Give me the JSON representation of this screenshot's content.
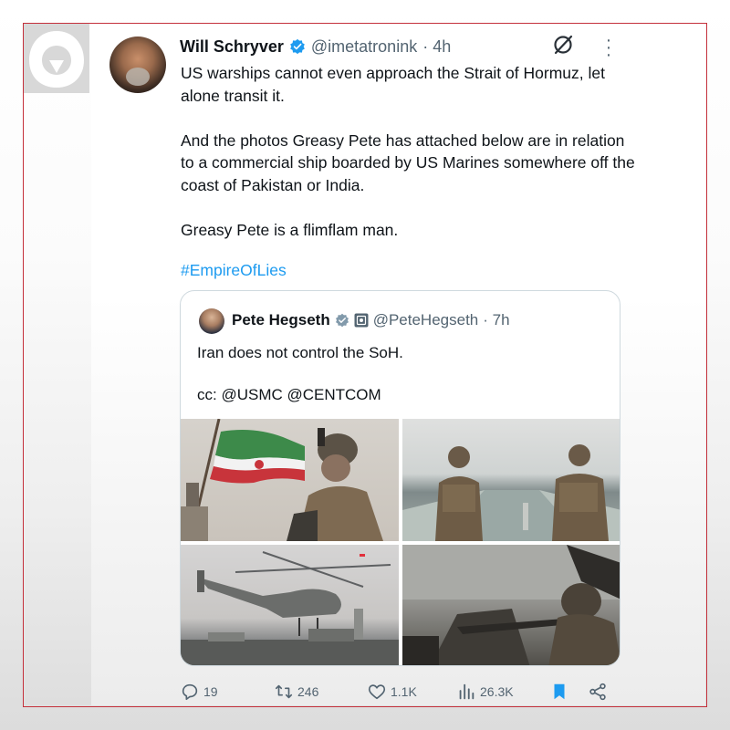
{
  "tweet": {
    "author_name": "Will Schryver",
    "author_handle": "@imetatronink",
    "time": "· 4h",
    "paragraphs": [
      "US warships cannot even approach the Strait of Hormuz, let alone transit it.",
      "And the photos Greasy Pete has attached below are in relation to a commercial ship boarded by US Marines somewhere off the coast of Pakistan or India.",
      "Greasy Pete is a flimflam man."
    ],
    "hashtag": "#EmpireOfLies"
  },
  "quote": {
    "author_name": "Pete Hegseth",
    "author_handle": "@PeteHegseth",
    "time": "· 7h",
    "paragraphs": [
      "Iran does not control the SoH.",
      "cc: @USMC @CENTCOM"
    ],
    "photos": [
      "soldier-with-iranian-flag",
      "soldiers-on-ship-deck",
      "helicopter-over-ship",
      "sniper-on-deck"
    ]
  },
  "actions": {
    "replies": "19",
    "reposts": "246",
    "likes": "1.1K",
    "views": "26.3K"
  },
  "colors": {
    "accent": "#1d9bf0",
    "frame": "#c4303b",
    "muted": "#536471"
  },
  "icons": [
    "grok-icon",
    "more-icon",
    "verified-icon",
    "gov-badge-icon",
    "reply-icon",
    "repost-icon",
    "like-icon",
    "views-icon",
    "bookmark-icon",
    "share-icon"
  ]
}
